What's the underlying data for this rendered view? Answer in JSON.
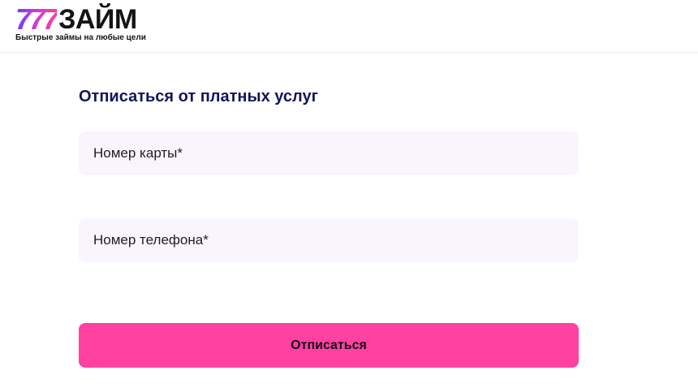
{
  "header": {
    "logo": {
      "digits": "777",
      "word": "ЗАЙМ",
      "tagline": "Быстрые займы на любые цели"
    }
  },
  "form": {
    "title": "Отписаться от платных услуг",
    "card_field": {
      "placeholder": "Номер карты*",
      "value": ""
    },
    "phone_field": {
      "placeholder": "Номер телефона*",
      "value": ""
    },
    "submit_label": "Отписаться"
  },
  "colors": {
    "brand_pink": "#ff41a1",
    "brand_purple": "#6a3cf0",
    "title_navy": "#15145a",
    "field_background": "#f9f4fd"
  }
}
